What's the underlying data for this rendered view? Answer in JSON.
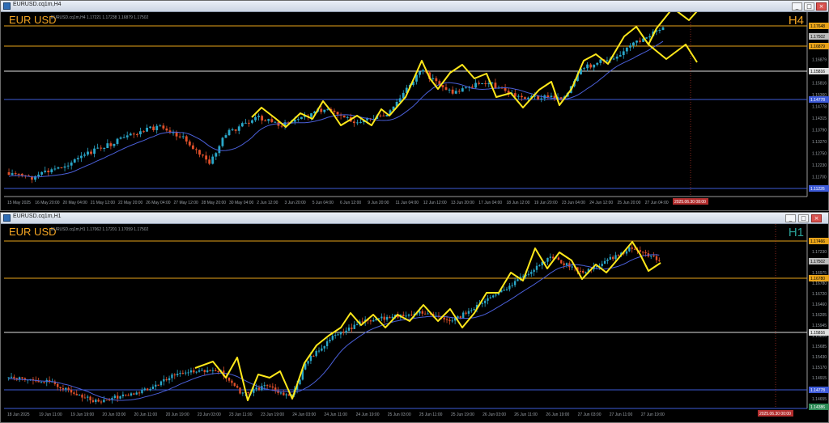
{
  "top_window": {
    "title": "EURUSD.cq1m,H4",
    "symbol_label": "EUR USD",
    "ohlc_text": "EURUSD.cq1m,H4 1.17221 1.17238 1.16879 1.17502",
    "timeframe_label": "H4",
    "price_ticks": [
      "1.17648",
      "1.17502",
      "1.16920",
      "1.16879",
      "1.16400",
      "1.15816",
      "1.15360",
      "1.14778",
      "1.14315",
      "1.13790",
      "1.13270",
      "1.12750",
      "1.12230",
      "1.11700",
      "1.11226",
      "1.11990"
    ],
    "price_tags": {
      "orange_top": "1.17648",
      "current": "1.17502",
      "orange_mid": "1.16879",
      "white": "1.15816",
      "blue": "1.14778",
      "bottom": "1.11226"
    },
    "time_labels": [
      "15 May 2025",
      "16 May 20:00",
      "20 May 04:00",
      "21 May 12:00",
      "22 May 20:00",
      "26 May 04:00",
      "27 May 12:00",
      "28 May 20:00",
      "30 May 04:00",
      "2 Jun 12:00",
      "3 Jun 20:00",
      "5 Jun 04:00",
      "6 Jun 12:00",
      "9 Jun 20:00",
      "11 Jun 04:00",
      "12 Jun 12:00",
      "13 Jun 20:00",
      "17 Jun 04:00",
      "18 Jun 12:00",
      "19 Jun 20:00",
      "23 Jun 04:00",
      "24 Jun 12:00",
      "25 Jun 20:00",
      "27 Jun 04:00"
    ],
    "cursor_time": "2025.06.30 08:00"
  },
  "bottom_window": {
    "title": "EURUSD.cq1m,H1",
    "symbol_label": "EUR USD",
    "ohlc_text": "EURUSD.cq1m,H1 1.17062 1.17201 1.17059 1.17502",
    "timeframe_label": "H1",
    "price_ticks": [
      "1.17466",
      "1.17230",
      "1.17502",
      "1.16975",
      "1.16780",
      "1.16720",
      "1.16460",
      "1.16205",
      "1.15945",
      "1.15816",
      "1.15685",
      "1.15430",
      "1.15170",
      "1.14915",
      "1.14778",
      "1.14655"
    ],
    "price_tags": {
      "orange_top": "1.17466",
      "current": "1.17502",
      "orange_mid": "1.16780",
      "white": "1.15816",
      "blue": "1.14778",
      "bottom": "1.14386"
    },
    "time_labels": [
      "18 Jun 2025",
      "19 Jun 11:00",
      "19 Jun 19:00",
      "20 Jun 03:00",
      "20 Jun 11:00",
      "20 Jun 19:00",
      "23 Jun 03:00",
      "23 Jun 11:00",
      "23 Jun 19:00",
      "24 Jun 03:00",
      "24 Jun 11:00",
      "24 Jun 19:00",
      "25 Jun 03:00",
      "25 Jun 11:00",
      "25 Jun 19:00",
      "26 Jun 03:00",
      "26 Jun 11:00",
      "26 Jun 19:00",
      "27 Jun 03:00",
      "27 Jun 11:00",
      "27 Jun 19:00"
    ],
    "cursor_time": "2025.06.30 00:00"
  },
  "window_controls": {
    "minimize": "_",
    "maximize": "□",
    "close": "×"
  },
  "colors": {
    "bull": "#2aa7c9",
    "bear": "#e0502a",
    "ma": "#4a5fd8",
    "zigzag": "#ffe81a",
    "orange_line": "#e8a31a",
    "white_line": "#e0e0e0",
    "blue_line": "#3e5bd8"
  }
}
